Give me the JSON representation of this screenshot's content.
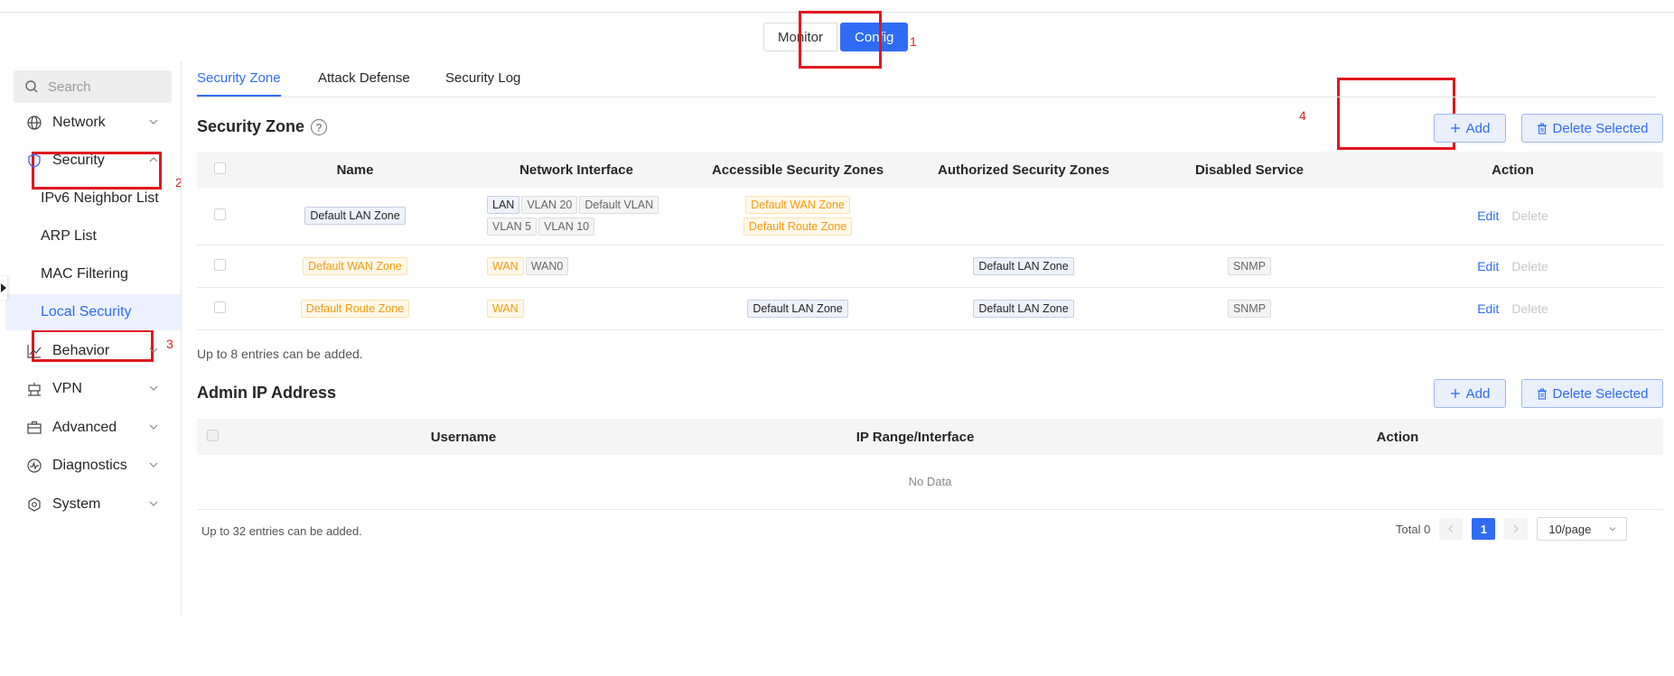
{
  "mode_switch": {
    "monitor_label": "Monitor",
    "config_label": "Config"
  },
  "annotations": {
    "a1": "1",
    "a2": "2",
    "a3": "3",
    "a4": "4"
  },
  "sidebar": {
    "search_placeholder": "Search",
    "items": [
      {
        "label": "Network",
        "icon": "globe-icon"
      },
      {
        "label": "Security",
        "icon": "shield-icon"
      },
      {
        "label": "Behavior",
        "icon": "chart-line-icon"
      },
      {
        "label": "VPN",
        "icon": "vpn-icon"
      },
      {
        "label": "Advanced",
        "icon": "briefcase-icon"
      },
      {
        "label": "Diagnostics",
        "icon": "diagnostics-icon"
      },
      {
        "label": "System",
        "icon": "system-icon"
      }
    ],
    "security_sub": [
      "IPv6 Neighbor List",
      "ARP List",
      "MAC Filtering",
      "Local Security"
    ]
  },
  "tabs": [
    "Security Zone",
    "Attack Defense",
    "Security Log"
  ],
  "security_zone": {
    "title": "Security Zone",
    "add_label": "Add",
    "delete_selected_label": "Delete Selected",
    "columns": [
      "Name",
      "Network Interface",
      "Accessible Security Zones",
      "Authorized Security Zones",
      "Disabled Service",
      "Action"
    ],
    "rows": [
      {
        "name": "Default LAN Zone",
        "interfaces": [
          "LAN",
          "VLAN 20",
          "Default VLAN",
          "VLAN 5",
          "VLAN 10"
        ],
        "accessible": [
          "Default WAN Zone",
          "Default Route Zone"
        ],
        "authorized": [],
        "disabled": []
      },
      {
        "name": "Default WAN Zone",
        "interfaces": [
          "WAN",
          "WAN0"
        ],
        "accessible": [],
        "authorized": [
          "Default LAN Zone"
        ],
        "disabled": [
          "SNMP"
        ]
      },
      {
        "name": "Default Route Zone",
        "interfaces": [
          "WAN"
        ],
        "accessible": [
          "Default LAN Zone"
        ],
        "authorized": [
          "Default LAN Zone"
        ],
        "disabled": [
          "SNMP"
        ]
      }
    ],
    "edit_label": "Edit",
    "delete_label": "Delete",
    "note": "Up to 8 entries can be added."
  },
  "admin_ip": {
    "title": "Admin IP Address",
    "add_label": "Add",
    "delete_selected_label": "Delete Selected",
    "columns": [
      "Username",
      "IP Range/Interface",
      "Action"
    ],
    "empty_text": "No Data",
    "note": "Up to 32 entries can be added.",
    "total_label": "Total 0",
    "current_page": "1",
    "page_size": "10/page"
  }
}
